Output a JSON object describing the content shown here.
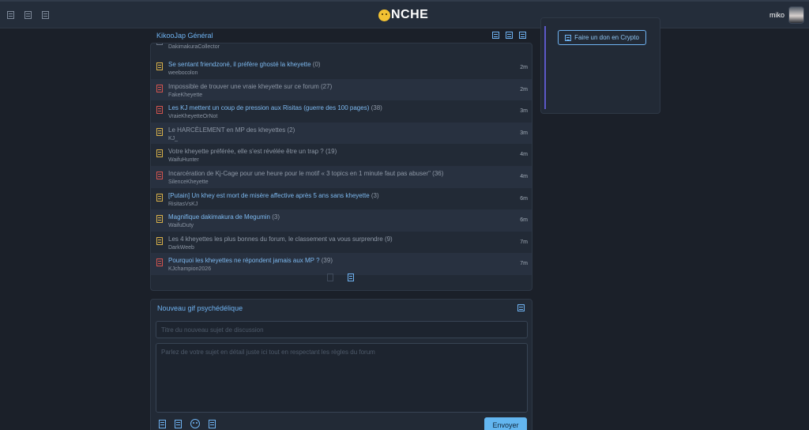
{
  "header": {
    "logo_text": "NCHE",
    "username": "miko",
    "icons": [
      "menu-icon",
      "list-icon",
      "grid-icon"
    ]
  },
  "forum": {
    "title": "KikooJap Général",
    "previous_author": "DakimakuraCollector",
    "topics": [
      {
        "title": "Se sentant friendzoné, il préfère ghosté la kheyette",
        "count": "(0)",
        "author": "weebocolon",
        "time": "2m",
        "icon": "yellow",
        "style": "link"
      },
      {
        "title": "Impossible de trouver une vraie kheyette sur ce forum",
        "count": "(27)",
        "author": "FakeKheyette",
        "time": "2m",
        "icon": "red",
        "style": "muted"
      },
      {
        "title": "Les KJ mettent un coup de pression aux Risitas (guerre des 100 pages)",
        "count": "(38)",
        "author": "VraieKheyetteOrNot",
        "time": "3m",
        "icon": "red",
        "style": "link"
      },
      {
        "title": "Le HARCÈLEMENT en MP des kheyettes",
        "count": "(2)",
        "author": "KJ_",
        "time": "3m",
        "icon": "yellow",
        "style": "muted"
      },
      {
        "title": "Votre kheyette préférée, elle s'est révélée être un trap ?",
        "count": "(19)",
        "author": "WaifuHunter",
        "time": "4m",
        "icon": "yellow",
        "style": "muted"
      },
      {
        "title": "Incarcération de Kj-Cage pour une heure pour le motif « 3 topics en 1 minute faut pas abuser\"",
        "count": "(36)",
        "author": "SilenceKheyette",
        "time": "4m",
        "icon": "red",
        "style": "muted"
      },
      {
        "title": "[Putain] Un khey est mort de misère affective après 5 ans sans kheyette",
        "count": "(3)",
        "author": "RisitasVsKJ",
        "time": "6m",
        "icon": "yellow",
        "style": "link"
      },
      {
        "title": "Magnifique dakimakura de Megumin",
        "count": "(3)",
        "author": "WaifuDuty",
        "time": "6m",
        "icon": "yellow",
        "style": "link"
      },
      {
        "title": "Les 4 kheyettes les plus bonnes du forum, le classement va vous surprendre",
        "count": "(9)",
        "author": "DarkWeeb",
        "time": "7m",
        "icon": "yellow",
        "style": "muted"
      },
      {
        "title": "Pourquoi les kheyettes ne répondent jamais aux MP ?",
        "count": "(39)",
        "author": "KJchampion2026",
        "time": "7m",
        "icon": "red",
        "style": "link"
      }
    ]
  },
  "new_topic": {
    "title": "Nouveau gif psychédélique",
    "subject_placeholder": "Titre du nouveau sujet de discussion",
    "body_placeholder": "Parlez de votre sujet en détail juste ici tout en respectant les règles du forum",
    "send_label": "Envoyer"
  },
  "sidebar": {
    "crypto_label": "Faire un don en Crypto"
  },
  "colors": {
    "accent": "#6fb3f2",
    "send_button": "#63b6f0",
    "icon_yellow": "#d9b14a",
    "icon_red": "#d4544f"
  }
}
